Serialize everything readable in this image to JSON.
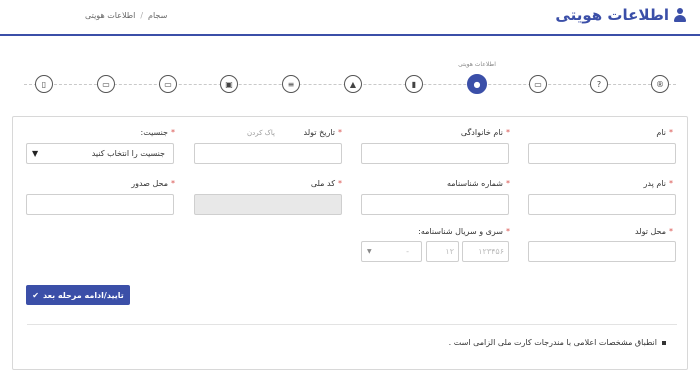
{
  "header": {
    "title": "اطلاعات هویتی",
    "breadcrumb": [
      "سجام",
      "اطلاعات هویتی"
    ]
  },
  "stepper": {
    "active_label": "اطلاعات هویتی",
    "steps": [
      {
        "icon": "registered-icon",
        "glyph": "®"
      },
      {
        "icon": "question-icon",
        "glyph": "?"
      },
      {
        "icon": "id-card-icon",
        "glyph": "▭"
      },
      {
        "icon": "fingerprint-icon",
        "glyph": "●"
      },
      {
        "icon": "bookmark-icon",
        "glyph": "▮"
      },
      {
        "icon": "graduation-cap-icon",
        "glyph": "▲"
      },
      {
        "icon": "list-icon",
        "glyph": "≡"
      },
      {
        "icon": "briefcase-icon",
        "glyph": "▣"
      },
      {
        "icon": "money-icon",
        "glyph": "▭"
      },
      {
        "icon": "credit-card-icon",
        "glyph": "▭"
      },
      {
        "icon": "document-icon",
        "glyph": "▯"
      }
    ]
  },
  "form": {
    "name_label": "نام",
    "family_label": "نام خانوادگی",
    "birth_date_label": "تاریخ تولد",
    "clear_link": "پاک کردن",
    "gender_label": "جنسیت:",
    "gender_placeholder": "جنسیت را انتخاب کنید",
    "father_label": "نام پدر",
    "cert_no_label": "شماره شناسنامه",
    "national_code_label": "کد ملی",
    "issue_place_label": "محل صدور",
    "birth_place_label": "محل تولد",
    "serial_label": "سری و سریال شناسنامه:",
    "serial_placeholder": "۱۲۳۴۵۶",
    "series_placeholder": "۱۲",
    "alpha_placeholder": "-",
    "submit": "تایید/ادامه مرحله بعد",
    "note": "انطباق مشخصات اعلامی با مندرجات کارت ملی الزامی است ."
  },
  "colors": {
    "primary": "#3b4fa8",
    "required": "#d9534f"
  }
}
